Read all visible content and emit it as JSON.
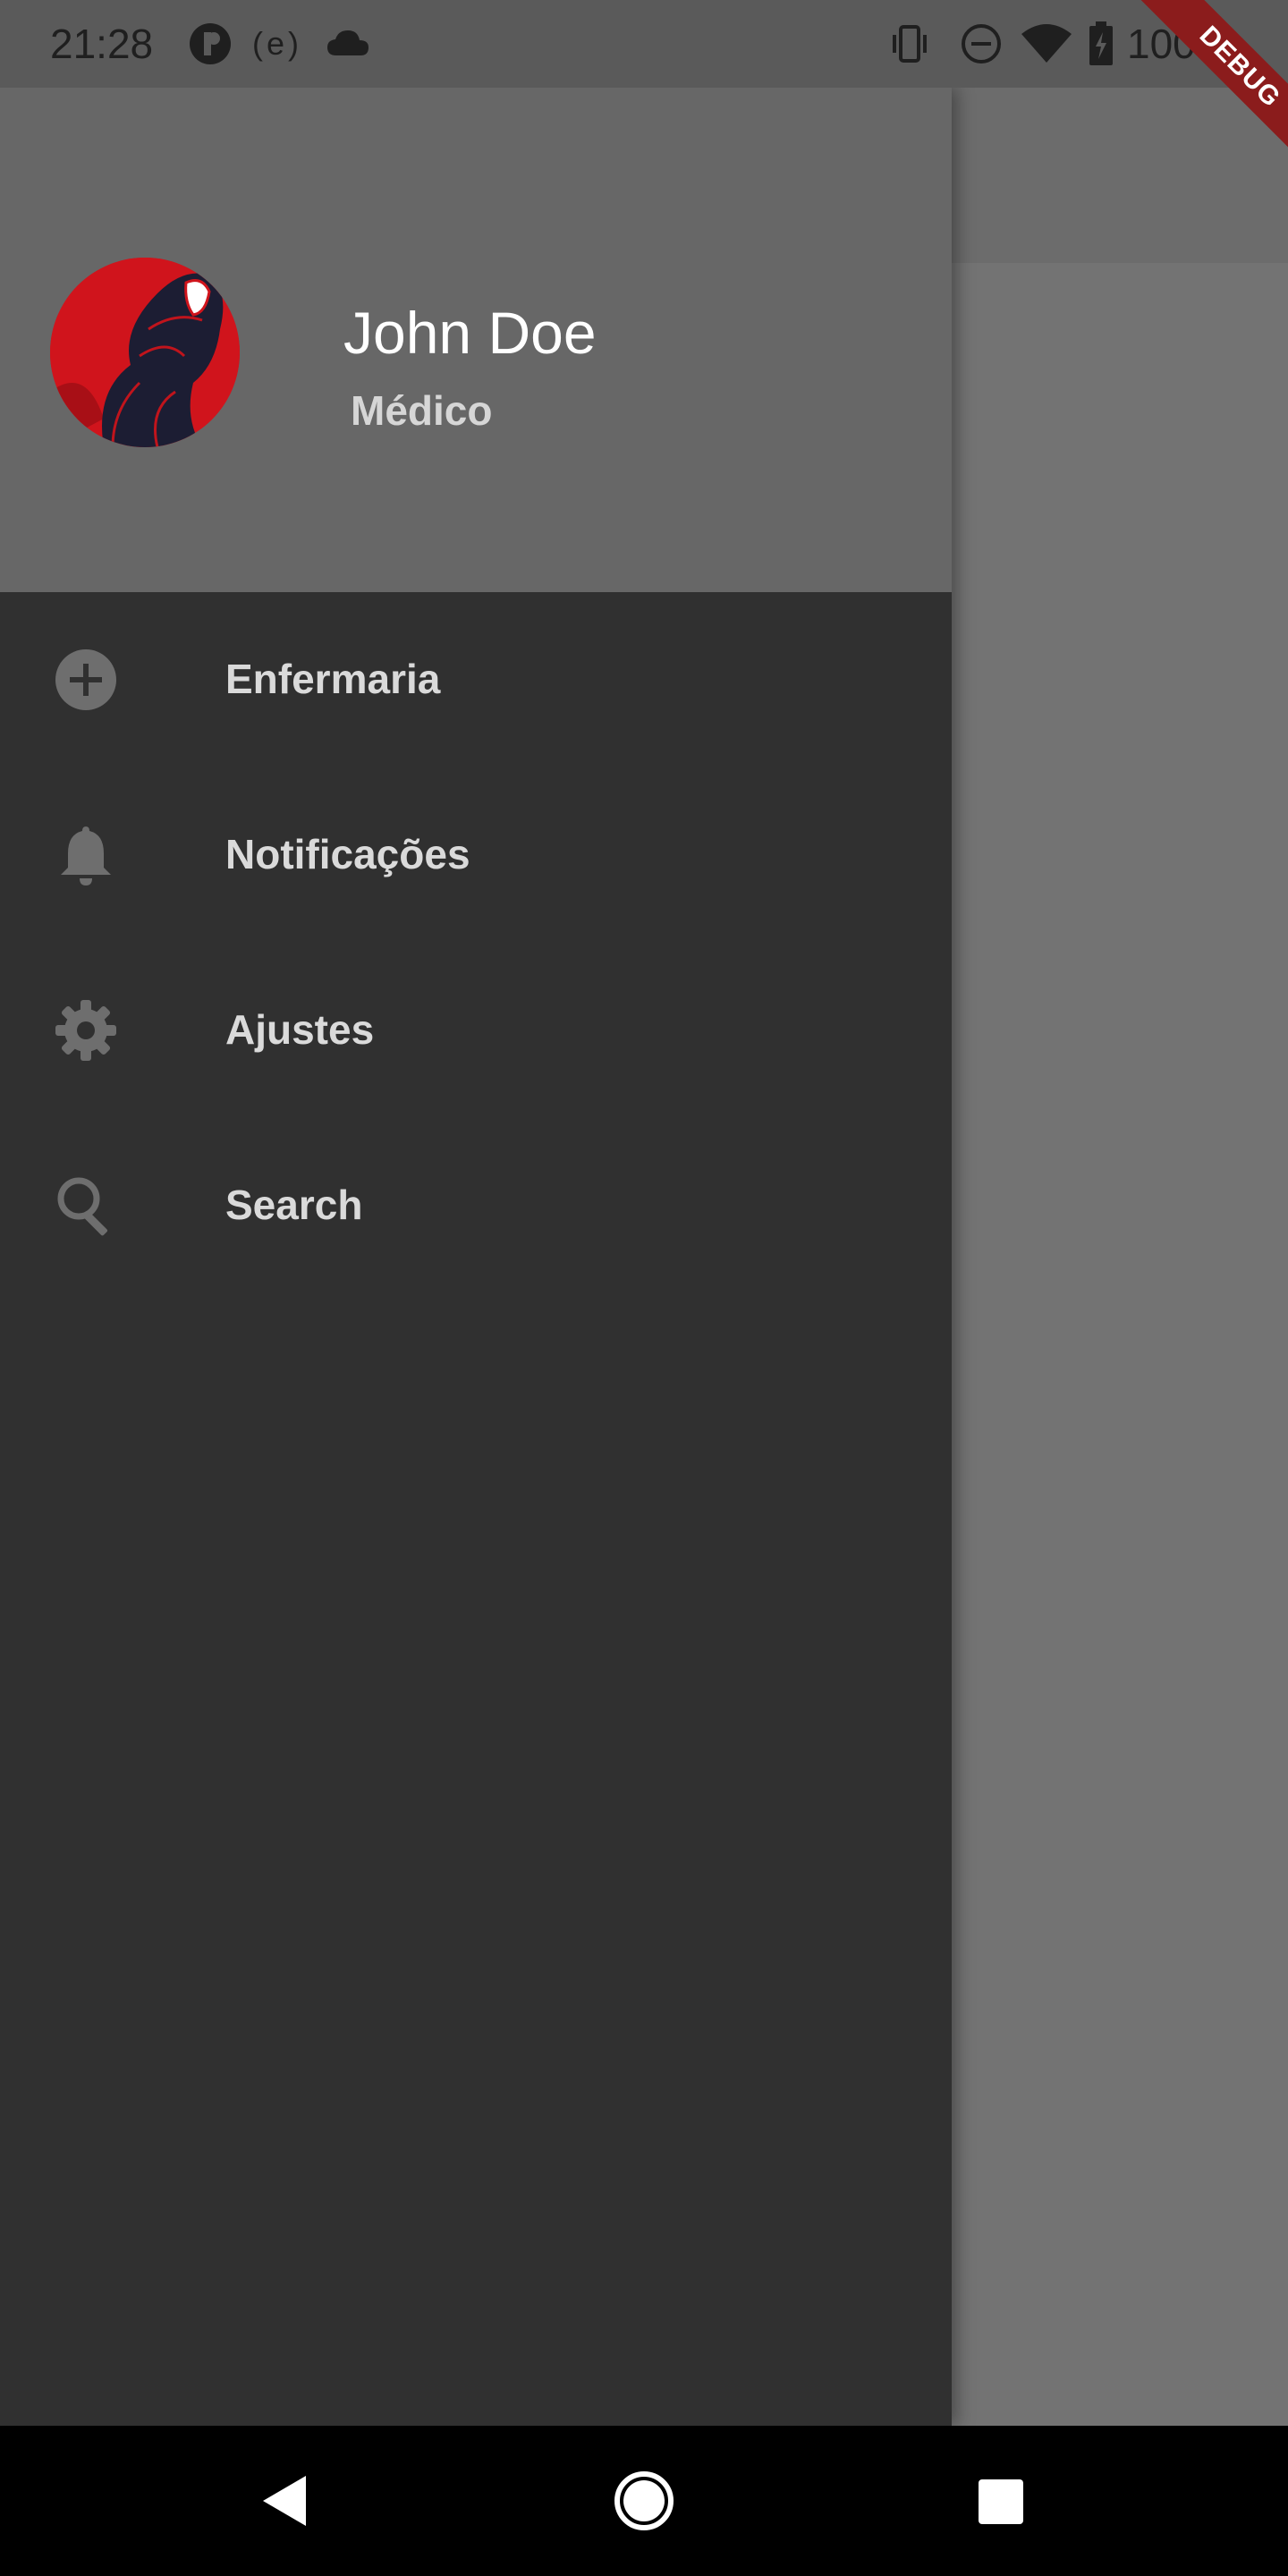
{
  "status_bar": {
    "time": "21:28",
    "battery_text": "100%",
    "icons": [
      "p-circle-icon",
      "e-parentheses-icon",
      "cloud-icon",
      "vibrate-icon",
      "do-not-disturb-icon",
      "wifi-icon",
      "battery-charging-icon"
    ],
    "middle_label": "(e)"
  },
  "debug_banner": "DEBUG",
  "drawer": {
    "header": {
      "name": "John Doe",
      "role": "Médico",
      "avatar": "spider-man-avatar"
    },
    "items": [
      {
        "label": "Enfermaria",
        "icon": "add-circle-icon"
      },
      {
        "label": "Notificações",
        "icon": "bell-icon"
      },
      {
        "label": "Ajustes",
        "icon": "gear-icon"
      },
      {
        "label": "Search",
        "icon": "search-icon"
      }
    ]
  },
  "nav_bar": {
    "buttons": [
      "back-icon",
      "home-icon",
      "recents-icon"
    ]
  },
  "colors": {
    "drawer_header": "#676767",
    "drawer_body": "#303030",
    "scrim": "#737373",
    "avatar_red": "#d0141c",
    "debug_red": "#8b1c1c"
  }
}
